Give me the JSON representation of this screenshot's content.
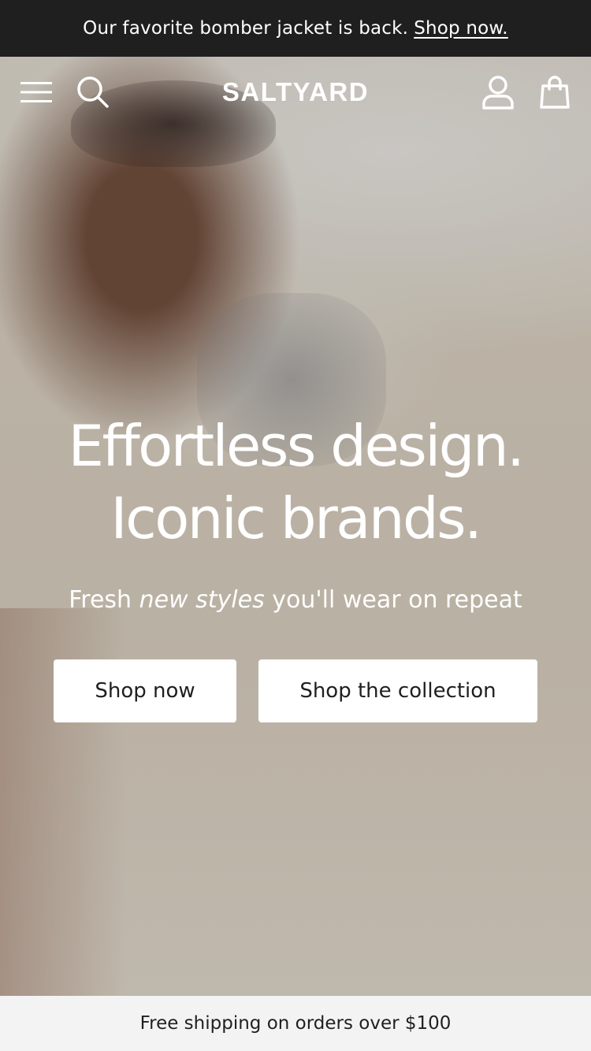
{
  "announcement": {
    "text": "Our favorite bomber jacket is back.",
    "link_label": "Shop now."
  },
  "header": {
    "brand": "SALTYARD",
    "icons": {
      "menu": "hamburger-menu-icon",
      "search": "search-icon",
      "account": "user-icon",
      "cart": "shopping-bag-icon"
    }
  },
  "hero": {
    "headline_line1": "Effortless design.",
    "headline_line2": "Iconic brands.",
    "subhead_pre": "Fresh",
    "subhead_em": "new styles",
    "subhead_post": "you'll wear on repeat",
    "primary_cta": "Shop now",
    "secondary_cta": "Shop the collection"
  },
  "footer_banner": {
    "text": "Free shipping on orders over $100"
  },
  "colors": {
    "announcement_bg": "#1f1f1f",
    "button_bg": "#ffffff",
    "text_dark": "#1f1f1f",
    "footer_bg": "#f3f3f4"
  }
}
